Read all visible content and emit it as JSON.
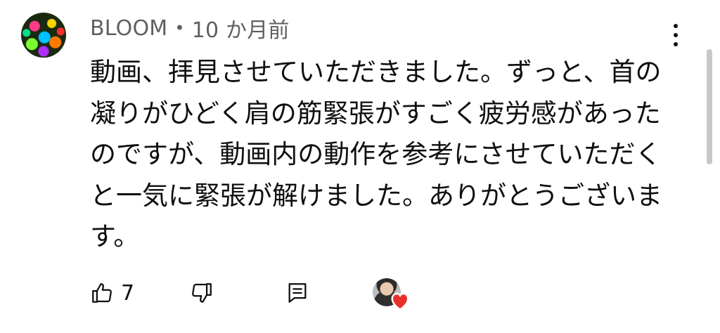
{
  "comment": {
    "author": "BLOOM",
    "separator": "•",
    "timestamp": "10 か月前",
    "lines": [
      "動画、拝見させていただきました。ずっと、首の",
      "凝りがひどく肩の筋緊張がすごく疲労感があった",
      "のですが、動画内の動作を参考にさせていただく",
      "と一気に緊張が解けました。ありがとうございま",
      "す。"
    ]
  },
  "actions": {
    "like_count": "7"
  },
  "icons": {
    "avatar": "user-avatar",
    "more": "more-vert-icon",
    "like": "thumbs-up-icon",
    "dislike": "thumbs-down-icon",
    "reply": "reply-comment-icon",
    "creator_heart": "creator-heart-icon"
  },
  "colors": {
    "text": "#0f0f0f",
    "secondary_text": "#606060",
    "heart": "#e8302b",
    "scrollbar": "#c8c8c8"
  }
}
